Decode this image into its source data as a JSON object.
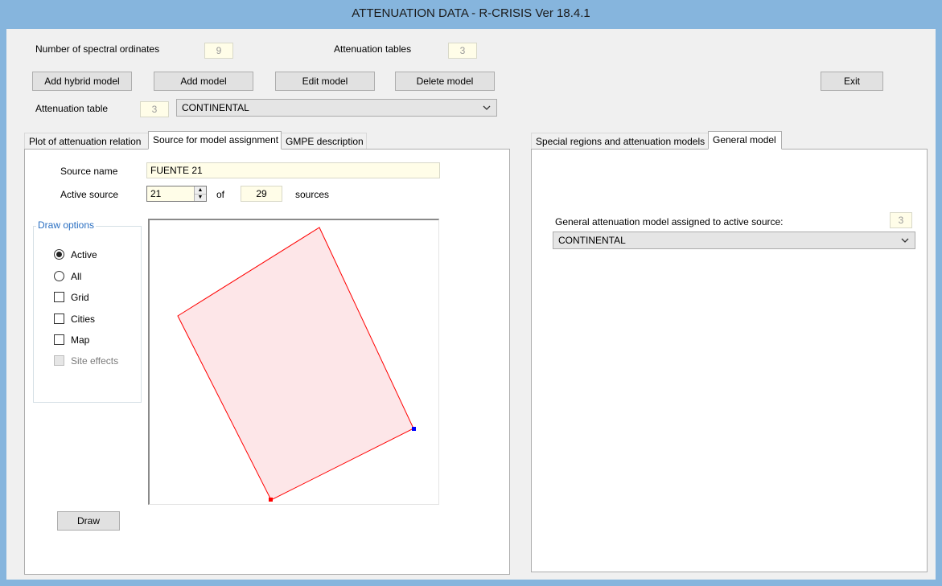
{
  "window": {
    "title": "ATTENUATION DATA - R-CRISIS Ver 18.4.1"
  },
  "top": {
    "spectral_label": "Number of spectral ordinates",
    "spectral_value": "9",
    "tables_label": "Attenuation tables",
    "tables_value": "3",
    "buttons": {
      "add_hybrid": "Add hybrid model",
      "add_model": "Add model",
      "edit_model": "Edit model",
      "delete_model": "Delete model",
      "exit": "Exit"
    },
    "atten_table_label": "Attenuation table",
    "atten_table_value": "3",
    "atten_table_combo": "CONTINENTAL"
  },
  "left": {
    "tabs": [
      "Plot of attenuation relation",
      "Source for model assignment",
      "GMPE description"
    ],
    "source_name_label": "Source name",
    "source_name_value": "FUENTE 21",
    "active_source_label": "Active source",
    "active_source_value": "21",
    "of_label": "of",
    "total_sources": "29",
    "sources_label": "sources",
    "draw_options": {
      "legend": "Draw options",
      "active": "Active",
      "all": "All",
      "grid": "Grid",
      "cities": "Cities",
      "map": "Map",
      "site_effects": "Site effects"
    },
    "draw_button": "Draw"
  },
  "right": {
    "tabs": [
      "Special regions and attenuation models",
      "General model"
    ],
    "general_label": "General attenuation model assigned to active source:",
    "general_value": "3",
    "general_combo": "CONTINENTAL"
  },
  "colors": {
    "polygon_fill": "#fde6e8",
    "polygon_stroke": "#ff0000",
    "vertex_blue": "#0000ff",
    "vertex_red": "#ff0000"
  }
}
